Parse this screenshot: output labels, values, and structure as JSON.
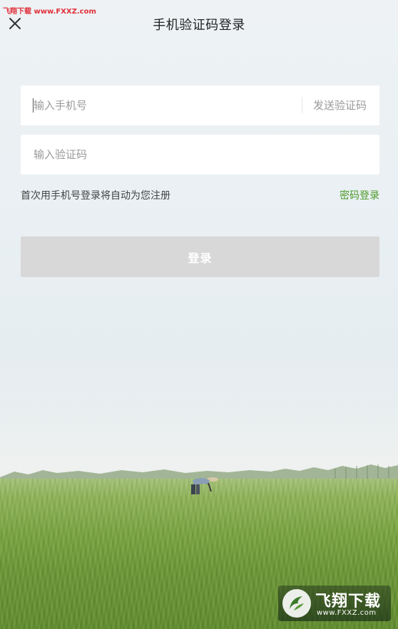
{
  "watermark_top": "飞翔下载 www.FXXZ.com",
  "header": {
    "title": "手机验证码登录",
    "close_icon": "close-icon"
  },
  "form": {
    "phone_placeholder": "输入手机号",
    "phone_value": "",
    "send_code_label": "发送验证码",
    "code_placeholder": "输入验证码",
    "code_value": "",
    "hint": "首次用手机号登录将自动为您注册",
    "password_login_label": "密码登录",
    "login_button_label": "登录"
  },
  "watermark_badge": {
    "name": "飞翔下载",
    "url": "www.FXXZ.com",
    "icon": "fxxz-logo-icon"
  },
  "colors": {
    "accent_green": "#4e9a2b",
    "button_disabled": "#d8d8d8",
    "placeholder": "#9a9a9a"
  }
}
